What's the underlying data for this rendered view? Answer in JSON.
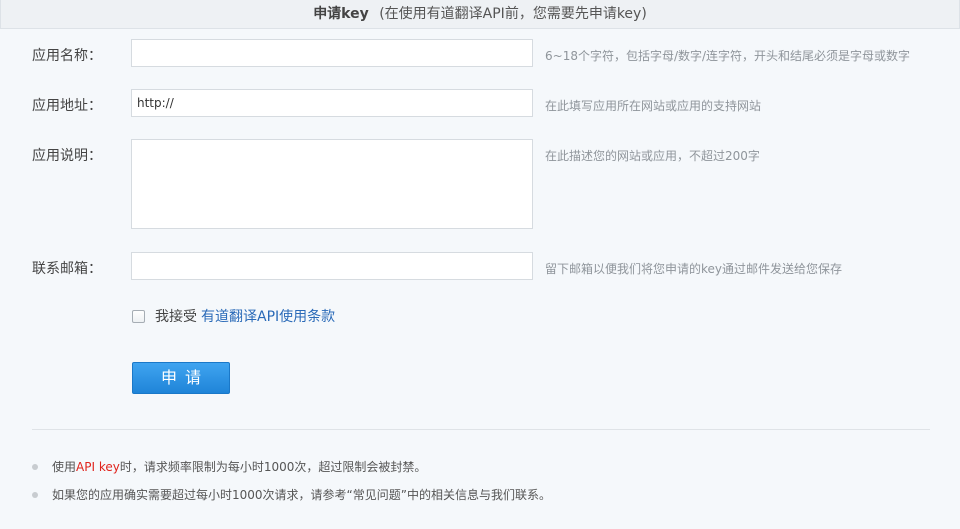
{
  "header": {
    "title": "申请key",
    "subtitle": "(在使用有道翻译API前，您需要先申请key)"
  },
  "form": {
    "app_name": {
      "label": "应用名称：",
      "value": "",
      "hint": "6~18个字符，包括字母/数字/连字符，开头和结尾必须是字母或数字"
    },
    "app_url": {
      "label": "应用地址：",
      "value": "http://",
      "hint": "在此填写应用所在网站或应用的支持网站"
    },
    "app_desc": {
      "label": "应用说明：",
      "value": "",
      "hint": "在此描述您的网站或应用，不超过200字"
    },
    "email": {
      "label": "联系邮箱：",
      "value": "",
      "hint": "留下邮箱以便我们将您申请的key通过邮件发送给您保存"
    },
    "agree": {
      "checked": false,
      "text": "我接受",
      "link": "有道翻译API使用条款"
    },
    "submit_label": "申请"
  },
  "notes": [
    {
      "pre": "使用",
      "highlight": "API key",
      "post": "时，请求频率限制为每小时1000次，超过限制会被封禁。"
    },
    {
      "text": "如果您的应用确实需要超过每小时1000次请求，请参考“常见问题”中的相关信息与我们联系。"
    }
  ],
  "colors": {
    "accent": "#1f84d8",
    "link": "#2a6ab8",
    "highlight": "#e0231c"
  }
}
